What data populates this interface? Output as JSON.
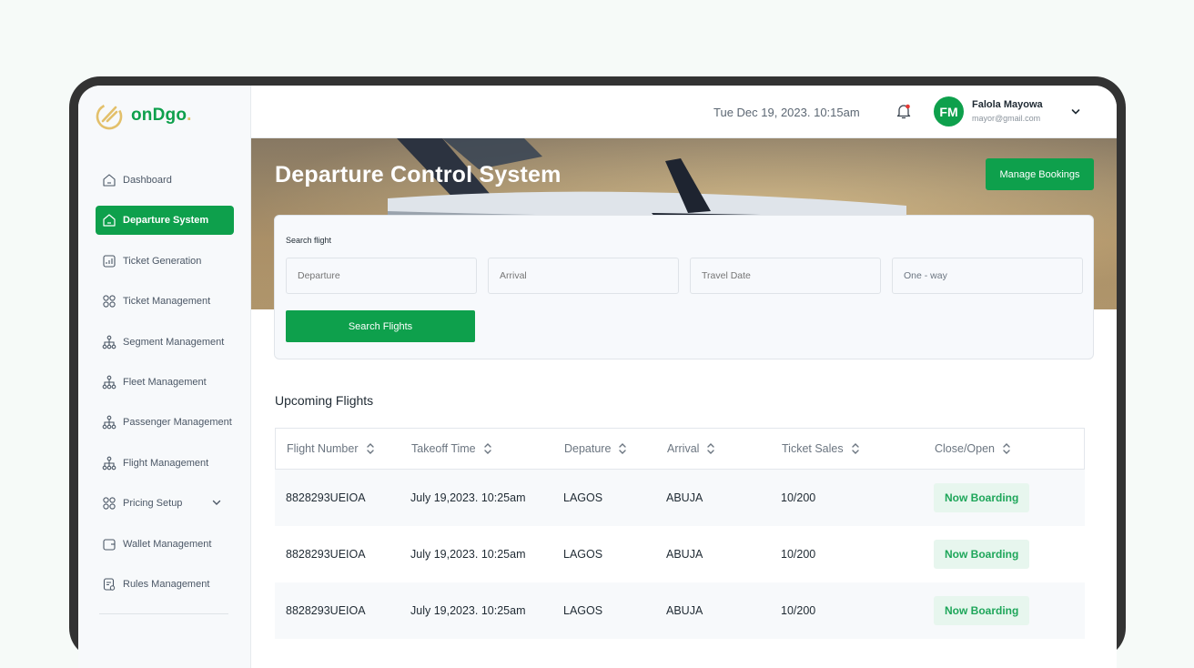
{
  "brand": {
    "name": "onDgo",
    "dot": "."
  },
  "sidebar": {
    "items": [
      {
        "label": "Dashboard",
        "icon": "home-icon",
        "active": false
      },
      {
        "label": "Departure System",
        "icon": "home-icon",
        "active": true
      },
      {
        "label": "Ticket Generation",
        "icon": "chart-icon",
        "active": false
      },
      {
        "label": "Ticket Management",
        "icon": "grid-icon",
        "active": false
      },
      {
        "label": "Segment Management",
        "icon": "hierarchy-icon",
        "active": false
      },
      {
        "label": "Fleet Management",
        "icon": "hierarchy-icon",
        "active": false
      },
      {
        "label": "Passenger Management",
        "icon": "hierarchy-icon",
        "active": false
      },
      {
        "label": "Flight Management",
        "icon": "hierarchy-icon",
        "active": false
      },
      {
        "label": "Pricing Setup",
        "icon": "grid-icon",
        "active": false,
        "expandable": true
      },
      {
        "label": "Wallet Management",
        "icon": "wallet-icon",
        "active": false
      },
      {
        "label": "Rules Management",
        "icon": "document-icon",
        "active": false
      }
    ]
  },
  "header": {
    "datetime": "Tue Dec 19, 2023. 10:15am",
    "user": {
      "initials": "FM",
      "name": "Falola Mayowa",
      "email": "mayor@gmail.com"
    }
  },
  "hero": {
    "title": "Departure Control System",
    "manage_label": "Manage Bookings"
  },
  "search": {
    "label": "Search flight",
    "departure_placeholder": "Departure",
    "arrival_placeholder": "Arrival",
    "date_placeholder": "Travel Date",
    "trip_type": "One - way",
    "button_label": "Search Flights"
  },
  "flights": {
    "title": "Upcoming Flights",
    "columns": [
      "Flight Number",
      "Takeoff Time",
      "Depature",
      "Arrival",
      "Ticket Sales",
      "Close/Open"
    ],
    "rows": [
      {
        "number": "8828293UEIOA",
        "time": "July 19,2023. 10:25am",
        "from": "LAGOS",
        "to": "ABUJA",
        "sales": "10/200",
        "status": "Now Boarding"
      },
      {
        "number": "8828293UEIOA",
        "time": "July 19,2023. 10:25am",
        "from": "LAGOS",
        "to": "ABUJA",
        "sales": "10/200",
        "status": "Now Boarding"
      },
      {
        "number": "8828293UEIOA",
        "time": "July 19,2023. 10:25am",
        "from": "LAGOS",
        "to": "ABUJA",
        "sales": "10/200",
        "status": "Now Boarding"
      }
    ]
  },
  "colors": {
    "primary": "#0ea04c",
    "badge_bg": "#e7f6ee",
    "notification": "#e53935"
  }
}
